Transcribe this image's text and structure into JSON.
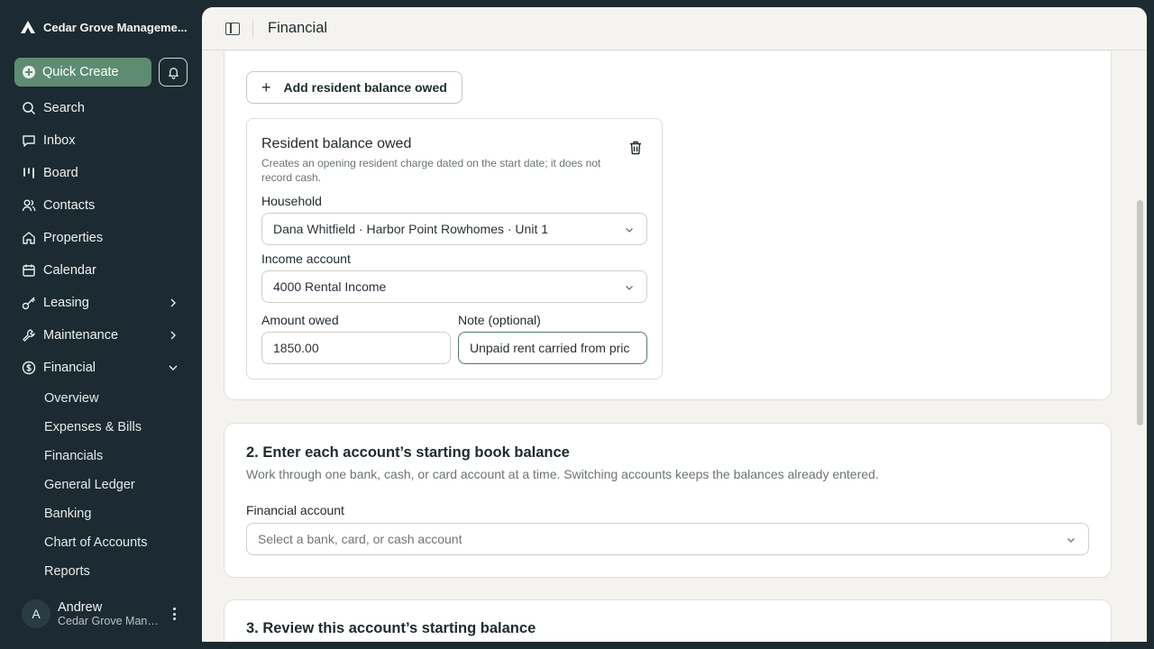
{
  "sidebar": {
    "org_name": "Cedar Grove Manageme...",
    "quick_create": "Quick Create",
    "items": [
      {
        "label": "Search",
        "icon": "search-icon"
      },
      {
        "label": "Inbox",
        "icon": "inbox-icon"
      },
      {
        "label": "Board",
        "icon": "board-icon"
      },
      {
        "label": "Contacts",
        "icon": "contacts-icon"
      },
      {
        "label": "Properties",
        "icon": "home-icon"
      },
      {
        "label": "Calendar",
        "icon": "calendar-icon"
      },
      {
        "label": "Leasing",
        "icon": "key-icon"
      },
      {
        "label": "Maintenance",
        "icon": "wrench-icon"
      },
      {
        "label": "Financial",
        "icon": "dollar-icon"
      }
    ],
    "financial_sub": [
      "Overview",
      "Expenses & Bills",
      "Financials",
      "General Ledger",
      "Banking",
      "Chart of Accounts",
      "Reports"
    ],
    "user": {
      "initial": "A",
      "name": "Andrew",
      "org": "Cedar Grove Management"
    }
  },
  "header": {
    "title": "Financial"
  },
  "section1": {
    "add_button": "Add resident balance owed",
    "resident_card": {
      "title": "Resident balance owed",
      "description": "Creates an opening resident charge dated on the start date; it does not record cash.",
      "household_label": "Household",
      "household_value": "Dana Whitfield · Harbor Point Rowhomes · Unit 1",
      "income_label": "Income account",
      "income_value": "4000 Rental Income",
      "amount_label": "Amount owed",
      "amount_value": "1850.00",
      "note_label": "Note (optional)",
      "note_value": "Unpaid rent carried from pric"
    }
  },
  "section2": {
    "title": "2. Enter each account’s starting book balance",
    "description": "Work through one bank, cash, or card account at a time. Switching accounts keeps the balances already entered.",
    "account_label": "Financial account",
    "account_placeholder": "Select a bank, card, or cash account"
  },
  "section3": {
    "title": "3. Review this account’s starting balance"
  },
  "colors": {
    "sidebar_bg": "#1c2b31",
    "accent": "#5e8c73",
    "main_bg": "#f4f3ef"
  }
}
